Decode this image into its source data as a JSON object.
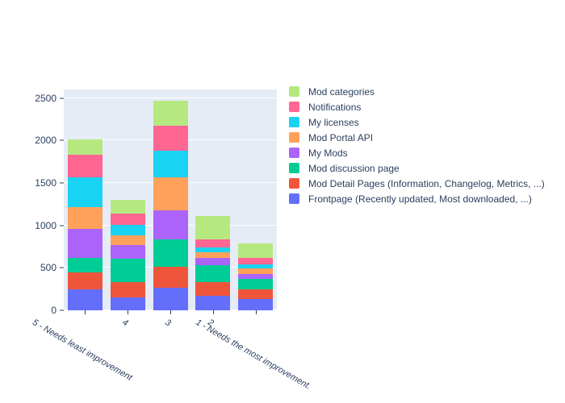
{
  "chart_data": {
    "type": "bar",
    "barmode": "stacked",
    "title": "",
    "xlabel": "",
    "ylabel": "",
    "ylim": [
      0,
      2600
    ],
    "yticks": [
      0,
      500,
      1000,
      1500,
      2000,
      2500
    ],
    "grid": true,
    "legend_position": "right",
    "categories": [
      "5 - Needs least improvement",
      "4",
      "3",
      "2",
      "1 - Needs the most improvement."
    ],
    "series": [
      {
        "name": "Frontpage (Recently updated, Most downloaded, ...)",
        "color": "#636efa",
        "values": [
          245,
          155,
          265,
          170,
          135
        ]
      },
      {
        "name": "Mod Detail Pages (Information, Changelog, Metrics, ...)",
        "color": "#ef553b",
        "values": [
          200,
          180,
          245,
          165,
          110
        ]
      },
      {
        "name": "Mod discussion page",
        "color": "#00cc96",
        "values": [
          175,
          275,
          330,
          200,
          125
        ]
      },
      {
        "name": "My Mods",
        "color": "#ab63fa",
        "values": [
          340,
          155,
          340,
          80,
          55
        ]
      },
      {
        "name": "Mod Portal API",
        "color": "#ffa15a",
        "values": [
          255,
          120,
          390,
          70,
          70
        ]
      },
      {
        "name": "My licenses",
        "color": "#19d3f3",
        "values": [
          355,
          125,
          310,
          60,
          45
        ]
      },
      {
        "name": "Notifications",
        "color": "#ff6692",
        "values": [
          265,
          130,
          295,
          90,
          80
        ]
      },
      {
        "name": "Mod categories",
        "color": "#b6e880",
        "values": [
          180,
          165,
          295,
          280,
          165
        ]
      }
    ],
    "totals": [
      2015,
      1305,
      2470,
      1115,
      785
    ]
  },
  "legend": {
    "items": [
      {
        "label": "Mod categories",
        "color": "#b6e880"
      },
      {
        "label": "Notifications",
        "color": "#ff6692"
      },
      {
        "label": "My licenses",
        "color": "#19d3f3"
      },
      {
        "label": "Mod Portal API",
        "color": "#ffa15a"
      },
      {
        "label": "My Mods",
        "color": "#ab63fa"
      },
      {
        "label": "Mod discussion page",
        "color": "#00cc96"
      },
      {
        "label": "Mod Detail Pages (Information, Changelog, Metrics, ...)",
        "color": "#ef553b"
      },
      {
        "label": "Frontpage (Recently updated, Most downloaded, ...)",
        "color": "#636efa"
      }
    ]
  },
  "axes": {
    "y_tick_labels": [
      "0",
      "500",
      "1000",
      "1500",
      "2000",
      "2500"
    ],
    "x_tick_labels": [
      "5 - Needs least improvement",
      "4",
      "3",
      "2",
      "1 - Needs the most improvement."
    ]
  },
  "style": {
    "plot_background": "#e5ecf6",
    "paper_background": "#ffffff",
    "gridline_color": "#ffffff",
    "text_color": "#2a3f5f"
  }
}
